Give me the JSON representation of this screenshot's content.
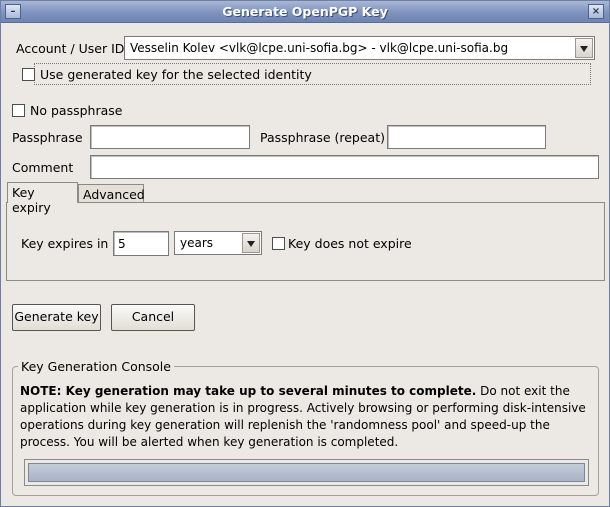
{
  "window": {
    "title": "Generate OpenPGP Key"
  },
  "account": {
    "label": "Account / User ID",
    "selected": "Vesselin Kolev <vlk@lcpe.uni-sofia.bg> - vlk@lcpe.uni-sofia.bg",
    "use_generated_key_label": "Use generated key for the selected identity",
    "use_generated_key_checked": false
  },
  "passphrase": {
    "no_passphrase_label": "No passphrase",
    "no_passphrase_checked": false,
    "passphrase_label": "Passphrase",
    "passphrase_value": "",
    "repeat_label": "Passphrase (repeat)",
    "repeat_value": "",
    "comment_label": "Comment",
    "comment_value": ""
  },
  "tabs": [
    {
      "label": "Key expiry",
      "active": true
    },
    {
      "label": "Advanced",
      "active": false
    }
  ],
  "expiry": {
    "label": "Key expires in",
    "value": "5",
    "unit": "years",
    "does_not_expire_label": "Key does not expire",
    "does_not_expire_checked": false
  },
  "actions": {
    "generate_label": "Generate key",
    "cancel_label": "Cancel"
  },
  "console": {
    "title": "Key Generation Console",
    "note_bold": "NOTE: Key generation may take up to several minutes to complete.",
    "note_text": " Do not exit the application while key generation is in progress. Actively browsing or performing disk-intensive operations during key generation will replenish the 'randomness pool' and speed-up the process. You will be alerted when key generation is completed.",
    "progress": 0
  }
}
